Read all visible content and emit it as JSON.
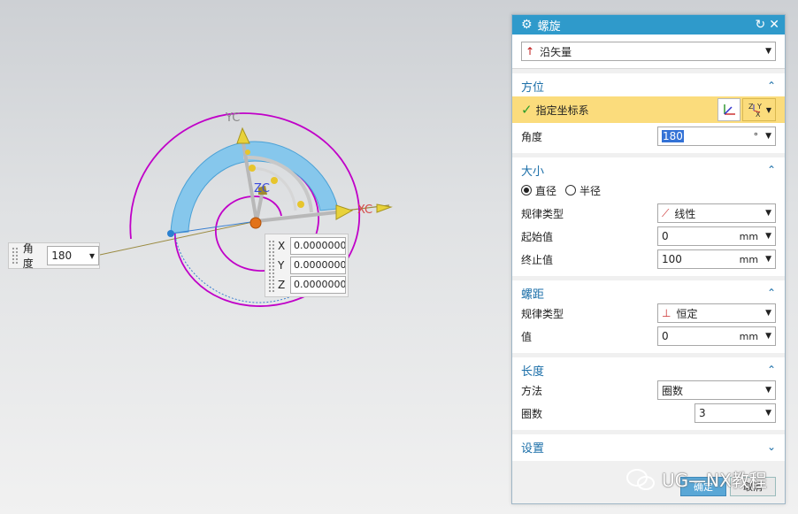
{
  "viewport": {
    "axis_yc": "YC",
    "axis_xc": "XC",
    "axis_zc": "ZC",
    "angle_input": {
      "label": "角度",
      "value": "180"
    },
    "coords": {
      "x_label": "X",
      "x_value": "0.0000000",
      "y_label": "Y",
      "y_value": "0.0000000",
      "z_label": "Z",
      "z_value": "0.0000000"
    }
  },
  "dialog": {
    "title": "螺旋",
    "type_select": "沿矢量",
    "orientation": {
      "title": "方位",
      "specify_csys": "指定坐标系",
      "angle_label": "角度",
      "angle_value": "180",
      "angle_unit": "°"
    },
    "size": {
      "title": "大小",
      "radio_diameter": "直径",
      "radio_radius": "半径",
      "law_type_label": "规律类型",
      "law_type_value": "线性",
      "start_label": "起始值",
      "start_value": "0",
      "start_unit": "mm",
      "end_label": "终止值",
      "end_value": "100",
      "end_unit": "mm"
    },
    "pitch": {
      "title": "螺距",
      "law_type_label": "规律类型",
      "law_type_value": "恒定",
      "value_label": "值",
      "value_value": "0",
      "value_unit": "mm"
    },
    "length": {
      "title": "长度",
      "method_label": "方法",
      "method_value": "圈数",
      "turns_label": "圈数",
      "turns_value": "3"
    },
    "settings": {
      "title": "设置"
    },
    "ok_label": "确定",
    "cancel_label": "取消"
  },
  "watermark": "UG—NX教程",
  "colors": {
    "title_bar": "#2f9acb",
    "section_title": "#1a6ea8",
    "highlight": "#fbdc7c",
    "spiral": "#c000c8"
  }
}
